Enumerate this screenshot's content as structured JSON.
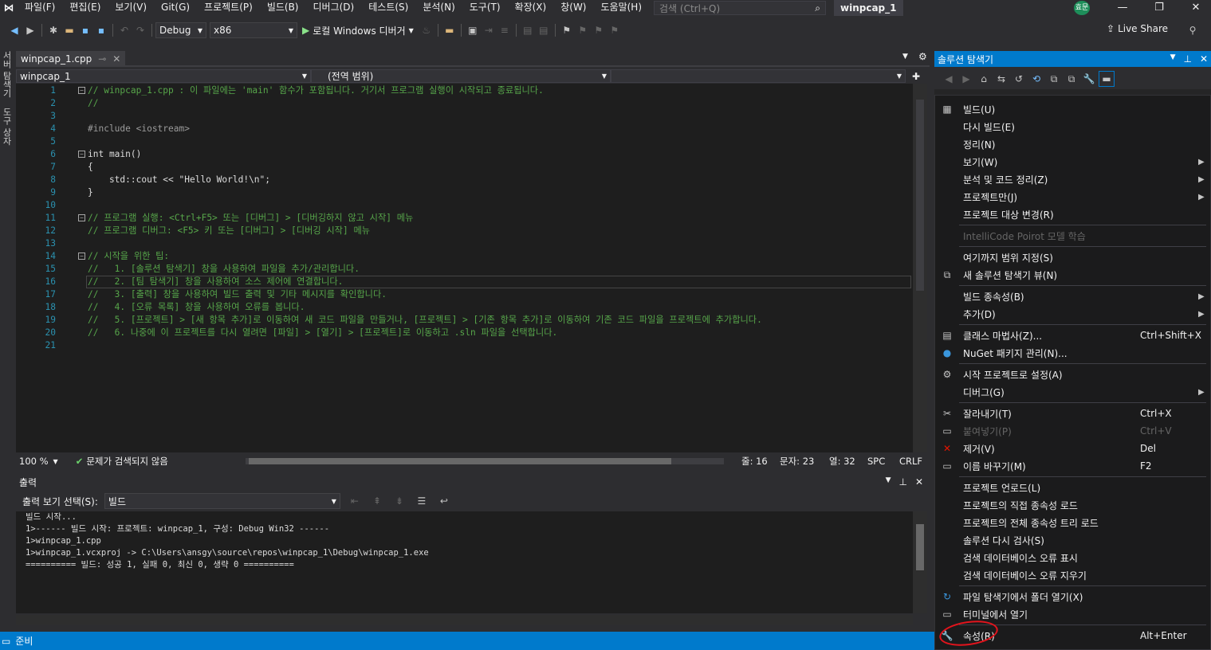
{
  "menubar": {
    "logo": "⋈",
    "items": [
      "파일(F)",
      "편집(E)",
      "보기(V)",
      "Git(G)",
      "프로젝트(P)",
      "빌드(B)",
      "디버그(D)",
      "테스트(S)",
      "분석(N)",
      "도구(T)",
      "확장(X)",
      "창(W)",
      "도움말(H)"
    ],
    "search_placeholder": "검색 (Ctrl+Q)",
    "solution_name": "winpcap_1",
    "avatar_initials": "효문",
    "minimize": "—",
    "restore": "❐",
    "close": "✕"
  },
  "toolbar": {
    "configuration": "Debug",
    "platform": "x86",
    "run_label": "로컬 Windows 디버거",
    "live_share": "Live Share"
  },
  "left_sidebar": {
    "tabs": [
      "서버 탐색기",
      "도구 상자"
    ]
  },
  "editor": {
    "file_tab": "winpcap_1.cpp",
    "nav_project": "winpcap_1",
    "nav_scope": "(전역 범위)",
    "lines": [
      {
        "n": "1",
        "text": "// winpcap_1.cpp : 이 파일에는 'main' 함수가 포함됩니다. 거기서 프로그램 실행이 시작되고 종료됩니다.",
        "type": "comment",
        "fold": "−"
      },
      {
        "n": "2",
        "text": "//",
        "type": "comment",
        "fold": ""
      },
      {
        "n": "3",
        "text": "",
        "type": "plain",
        "fold": ""
      },
      {
        "n": "4",
        "text": "#include <iostream>",
        "type": "preproc",
        "fold": ""
      },
      {
        "n": "5",
        "text": "",
        "type": "plain",
        "fold": ""
      },
      {
        "n": "6",
        "text": "int main()",
        "type": "keyword",
        "fold": "−"
      },
      {
        "n": "7",
        "text": "{",
        "type": "plain",
        "fold": ""
      },
      {
        "n": "8",
        "text": "    std::cout << \"Hello World!\\n\";",
        "type": "string",
        "fold": ""
      },
      {
        "n": "9",
        "text": "}",
        "type": "plain",
        "fold": ""
      },
      {
        "n": "10",
        "text": "",
        "type": "plain",
        "fold": ""
      },
      {
        "n": "11",
        "text": "// 프로그램 실행: <Ctrl+F5> 또는 [디버그] > [디버깅하지 않고 시작] 메뉴",
        "type": "comment",
        "fold": "−"
      },
      {
        "n": "12",
        "text": "// 프로그램 디버그: <F5> 키 또는 [디버그] > [디버깅 시작] 메뉴",
        "type": "comment",
        "fold": ""
      },
      {
        "n": "13",
        "text": "",
        "type": "plain",
        "fold": ""
      },
      {
        "n": "14",
        "text": "// 시작을 위한 팁:",
        "type": "comment",
        "fold": "−"
      },
      {
        "n": "15",
        "text": "//   1. [솔루션 탐색기] 창을 사용하여 파일을 추가/관리합니다.",
        "type": "comment",
        "fold": ""
      },
      {
        "n": "16",
        "text": "//   2. [팀 탐색기] 창을 사용하여 소스 제어에 연결합니다.",
        "type": "comment",
        "fold": ""
      },
      {
        "n": "17",
        "text": "//   3. [출력] 창을 사용하여 빌드 출력 및 기타 메시지를 확인합니다.",
        "type": "comment",
        "fold": ""
      },
      {
        "n": "18",
        "text": "//   4. [오류 목록] 창을 사용하여 오류를 봅니다.",
        "type": "comment",
        "fold": ""
      },
      {
        "n": "19",
        "text": "//   5. [프로젝트] > [새 항목 추가]로 이동하여 새 코드 파일을 만들거나, [프로젝트] > [기존 항목 추가]로 이동하여 기존 코드 파일을 프로젝트에 추가합니다.",
        "type": "comment",
        "fold": ""
      },
      {
        "n": "20",
        "text": "//   6. 나중에 이 프로젝트를 다시 열려면 [파일] > [열기] > [프로젝트]로 이동하고 .sln 파일을 선택합니다.",
        "type": "comment",
        "fold": ""
      },
      {
        "n": "21",
        "text": "",
        "type": "plain",
        "fold": ""
      }
    ],
    "status": {
      "zoom": "100 %",
      "issues": "문제가 검색되지 않음",
      "line": "줄: 16",
      "char": "문자: 23",
      "col": "열: 32",
      "whitespace": "SPC",
      "eol": "CRLF"
    }
  },
  "output": {
    "title": "출력",
    "source_label": "출력 보기 선택(S):",
    "source_value": "빌드",
    "lines": [
      "빌드 시작...",
      "1>------ 빌드 시작: 프로젝트: winpcap_1, 구성: Debug Win32 ------",
      "1>winpcap_1.cpp",
      "1>winpcap_1.vcxproj -> C:\\Users\\ansgy\\source\\repos\\winpcap_1\\Debug\\winpcap_1.exe",
      "========== 빌드: 성공 1, 실패 0, 최신 0, 생략 0 =========="
    ]
  },
  "status_bar": {
    "text": "준비"
  },
  "solution_explorer": {
    "title": "솔루션 탐색기"
  },
  "context_menu": {
    "items": [
      {
        "label": "빌드(U)",
        "shortcut": "",
        "arrow": false,
        "icon": "build-icon",
        "glyph": "▦",
        "disabled": false
      },
      {
        "label": "다시 빌드(E)",
        "shortcut": "",
        "arrow": false,
        "icon": "",
        "glyph": "",
        "disabled": false
      },
      {
        "label": "정리(N)",
        "shortcut": "",
        "arrow": false,
        "icon": "",
        "glyph": "",
        "disabled": false
      },
      {
        "label": "보기(W)",
        "shortcut": "",
        "arrow": true,
        "icon": "",
        "glyph": "",
        "disabled": false
      },
      {
        "label": "분석 및 코드 정리(Z)",
        "shortcut": "",
        "arrow": true,
        "icon": "",
        "glyph": "",
        "disabled": false
      },
      {
        "label": "프로젝트만(J)",
        "shortcut": "",
        "arrow": true,
        "icon": "",
        "glyph": "",
        "disabled": false
      },
      {
        "label": "프로젝트 대상 변경(R)",
        "shortcut": "",
        "arrow": false,
        "icon": "",
        "glyph": "",
        "disabled": false
      },
      {
        "label": "IntelliCode Poirot 모델 학습",
        "shortcut": "",
        "arrow": false,
        "icon": "",
        "glyph": "",
        "disabled": true
      },
      {
        "label": "여기까지 범위 지정(S)",
        "shortcut": "",
        "arrow": false,
        "icon": "",
        "glyph": "",
        "disabled": false
      },
      {
        "label": "새 솔루션 탐색기 뷰(N)",
        "shortcut": "",
        "arrow": false,
        "icon": "new-view-icon",
        "glyph": "⧉",
        "disabled": false
      },
      {
        "label": "빌드 종속성(B)",
        "shortcut": "",
        "arrow": true,
        "icon": "",
        "glyph": "",
        "disabled": false
      },
      {
        "label": "추가(D)",
        "shortcut": "",
        "arrow": true,
        "icon": "",
        "glyph": "",
        "disabled": false
      },
      {
        "label": "클래스 마법사(Z)...",
        "shortcut": "Ctrl+Shift+X",
        "arrow": false,
        "icon": "class-wizard-icon",
        "glyph": "▤",
        "disabled": false
      },
      {
        "label": "NuGet 패키지 관리(N)...",
        "shortcut": "",
        "arrow": false,
        "icon": "nuget-icon",
        "glyph": "●",
        "disabled": false
      },
      {
        "label": "시작 프로젝트로 설정(A)",
        "shortcut": "",
        "arrow": false,
        "icon": "gear-icon",
        "glyph": "⚙",
        "disabled": false
      },
      {
        "label": "디버그(G)",
        "shortcut": "",
        "arrow": true,
        "icon": "",
        "glyph": "",
        "disabled": false
      },
      {
        "label": "잘라내기(T)",
        "shortcut": "Ctrl+X",
        "arrow": false,
        "icon": "scissors-icon",
        "glyph": "✂",
        "disabled": false
      },
      {
        "label": "붙여넣기(P)",
        "shortcut": "Ctrl+V",
        "arrow": false,
        "icon": "paste-icon",
        "glyph": "▭",
        "disabled": true
      },
      {
        "label": "제거(V)",
        "shortcut": "Del",
        "arrow": false,
        "icon": "delete-x-icon",
        "glyph": "✕",
        "disabled": false
      },
      {
        "label": "이름 바꾸기(M)",
        "shortcut": "F2",
        "arrow": false,
        "icon": "rename-icon",
        "glyph": "▭",
        "disabled": false
      },
      {
        "label": "프로젝트 언로드(L)",
        "shortcut": "",
        "arrow": false,
        "icon": "",
        "glyph": "",
        "disabled": false
      },
      {
        "label": "프로젝트의 직접 종속성 로드",
        "shortcut": "",
        "arrow": false,
        "icon": "",
        "glyph": "",
        "disabled": false
      },
      {
        "label": "프로젝트의 전체 종속성 트리 로드",
        "shortcut": "",
        "arrow": false,
        "icon": "",
        "glyph": "",
        "disabled": false
      },
      {
        "label": "솔루션 다시 검사(S)",
        "shortcut": "",
        "arrow": false,
        "icon": "",
        "glyph": "",
        "disabled": false
      },
      {
        "label": "검색 데이터베이스 오류 표시",
        "shortcut": "",
        "arrow": false,
        "icon": "",
        "glyph": "",
        "disabled": false
      },
      {
        "label": "검색 데이터베이스 오류 지우기",
        "shortcut": "",
        "arrow": false,
        "icon": "",
        "glyph": "",
        "disabled": false
      },
      {
        "label": "파일 탐색기에서 폴더 열기(X)",
        "shortcut": "",
        "arrow": false,
        "icon": "open-folder-icon",
        "glyph": "↻",
        "disabled": false
      },
      {
        "label": "터미널에서 열기",
        "shortcut": "",
        "arrow": false,
        "icon": "terminal-icon",
        "glyph": "▭",
        "disabled": false
      },
      {
        "label": "속성(R)",
        "shortcut": "Alt+Enter",
        "arrow": false,
        "icon": "wrench-icon",
        "glyph": "🔧",
        "disabled": false
      }
    ]
  },
  "colors": {
    "accent": "#007acc",
    "annotation": "#e3141c"
  }
}
